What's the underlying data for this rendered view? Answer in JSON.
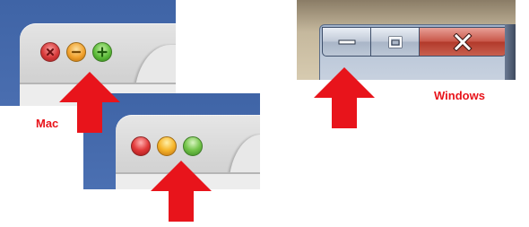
{
  "labels": {
    "mac": "Mac",
    "windows": "Windows"
  },
  "colors": {
    "annotation": "#e8141b",
    "mac_titlebar": "#3f64a6",
    "mac_close": "#d83b3b",
    "mac_minimize": "#f1a12d",
    "mac_zoom": "#5dbc3a",
    "windows_close": "#c9584a",
    "windows_button": "#c1cad8"
  },
  "mac_window_controls": {
    "state_hover": {
      "buttons": [
        {
          "name": "close",
          "icon": "x-icon"
        },
        {
          "name": "minimize",
          "icon": "minus-icon"
        },
        {
          "name": "zoom",
          "icon": "plus-icon"
        }
      ]
    },
    "state_plain": {
      "buttons": [
        {
          "name": "close",
          "icon": "none"
        },
        {
          "name": "minimize",
          "icon": "none"
        },
        {
          "name": "zoom",
          "icon": "none"
        }
      ]
    }
  },
  "windows_window_controls": {
    "buttons": [
      {
        "name": "minimize",
        "icon": "minimize-dash-icon"
      },
      {
        "name": "maximize",
        "icon": "maximize-square-icon"
      },
      {
        "name": "close",
        "icon": "x-icon"
      }
    ]
  },
  "annotations": {
    "arrows": [
      {
        "points_to": "mac-minimize-button-hover",
        "icon": "red-up-arrow-icon"
      },
      {
        "points_to": "mac-minimize-button",
        "icon": "red-up-arrow-icon"
      },
      {
        "points_to": "windows-minimize-button",
        "icon": "red-up-arrow-icon"
      }
    ]
  }
}
